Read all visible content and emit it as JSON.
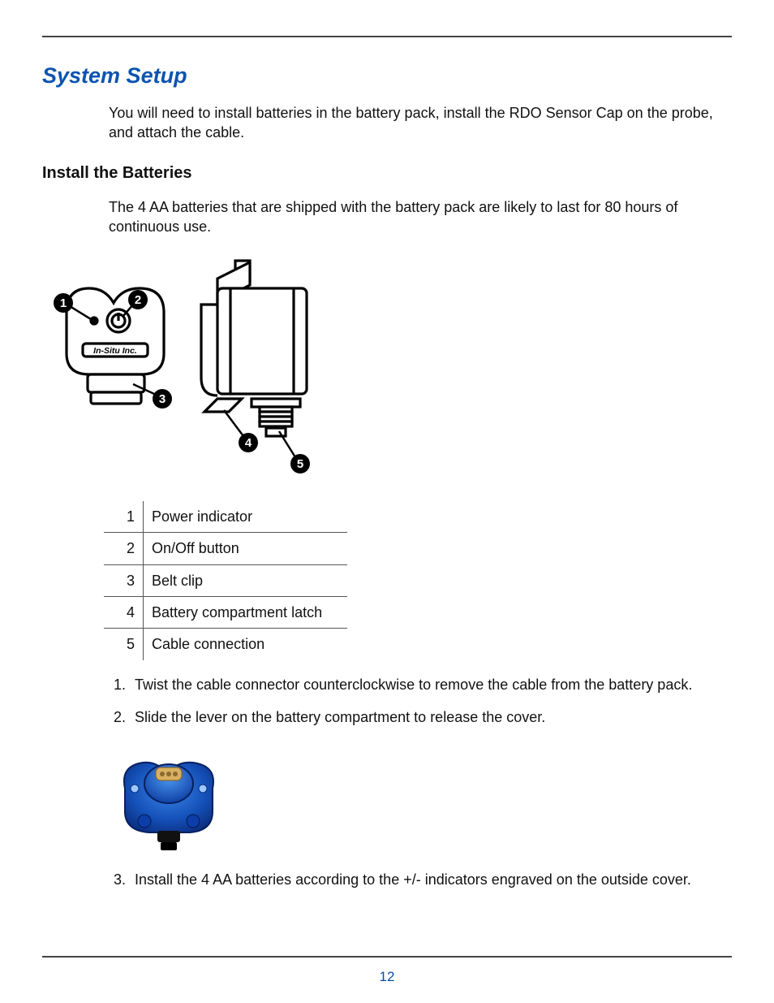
{
  "page_number": "12",
  "section_title": "System Setup",
  "intro": "You will need to install batteries in the battery pack, install the RDO Sensor Cap on the probe, and attach the cable.",
  "subsection_title": "Install the Batteries",
  "sub_intro": "The 4 AA batteries that are shipped with the battery pack are likely to last for 80 hours of continuous use.",
  "diagram_brand_text": "In-Situ Inc.",
  "legend": [
    {
      "num": "1",
      "label": "Power indicator"
    },
    {
      "num": "2",
      "label": "On/Off button"
    },
    {
      "num": "3",
      "label": "Belt clip"
    },
    {
      "num": "4",
      "label": "Battery compartment latch"
    },
    {
      "num": "5",
      "label": "Cable connection"
    }
  ],
  "steps": {
    "s1": "Twist the cable connector counterclockwise to remove the cable from the battery pack.",
    "s2": "Slide the lever on the battery compartment to release the cover.",
    "s3": "Install the 4 AA batteries according to the +/- indicators engraved on the outside cover."
  }
}
